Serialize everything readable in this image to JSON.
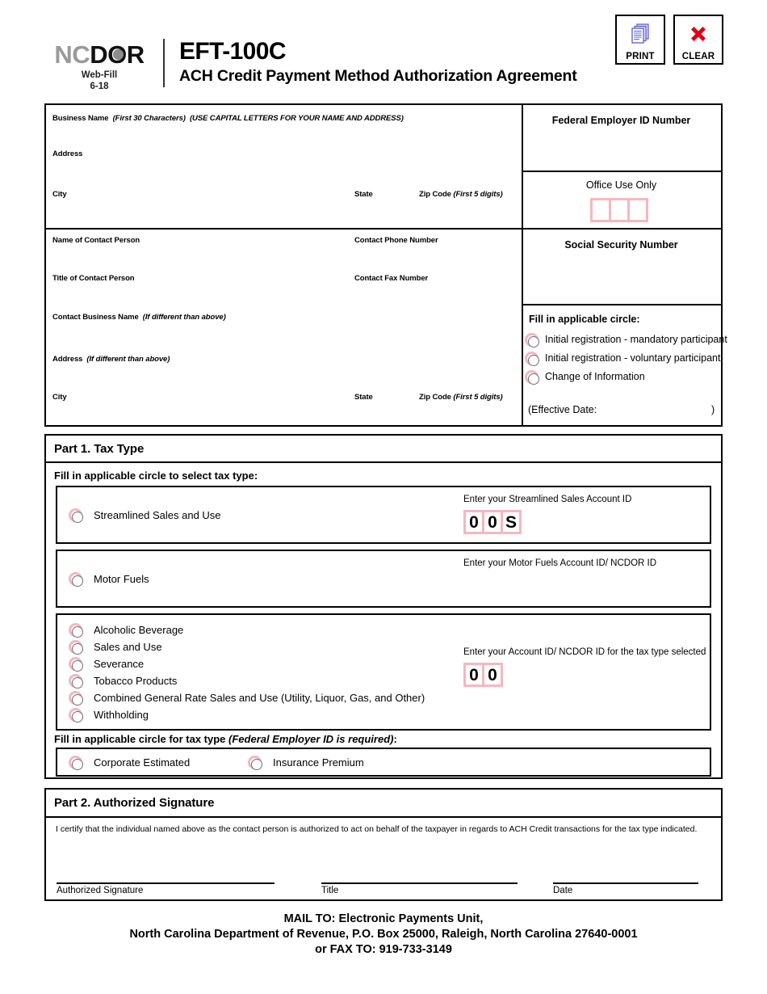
{
  "header": {
    "logo": {
      "part1": "NC",
      "part2": "DOR",
      "subtitle_line1": "Web-Fill",
      "subtitle_line2": "6-18"
    },
    "form_number": "EFT-100C",
    "form_title": "ACH Credit Payment Method Authorization Agreement",
    "print_button": "PRINT",
    "clear_button": "CLEAR"
  },
  "business": {
    "business_name_label": "Business Name",
    "business_name_note1": "(First 30 Characters)",
    "business_name_note2": "(USE CAPITAL LETTERS FOR YOUR NAME AND ADDRESS)",
    "address_label": "Address",
    "city_label": "City",
    "state_label": "State",
    "zip_label": "Zip Code",
    "zip_note": "(First 5 digits)"
  },
  "federal_id": {
    "title": "Federal Employer ID Number"
  },
  "office_use": {
    "title": "Office Use Only",
    "boxes": [
      "",
      "",
      ""
    ]
  },
  "contact": {
    "name_label": "Name of Contact Person",
    "phone_label": "Contact Phone Number",
    "title_label": "Title of Contact Person",
    "fax_label": "Contact Fax Number",
    "business_name_label": "Contact Business Name",
    "business_name_note": "(If different than above)",
    "address_label": "Address",
    "address_note": "(If different than above)",
    "city_label": "City",
    "state_label": "State",
    "zip_label": "Zip Code",
    "zip_note": "(First 5 digits)"
  },
  "ssn": {
    "title": "Social Security Number"
  },
  "registration": {
    "prompt": "Fill in applicable circle:",
    "options": [
      "Initial registration - mandatory participant",
      "Initial registration - voluntary participant",
      "Change of Information"
    ],
    "effective_date_open": "(Effective Date:",
    "effective_date_close": ")"
  },
  "part1": {
    "heading": "Part 1.  Tax Type",
    "prompt": "Fill in applicable circle to select tax type:",
    "streamlined": {
      "option_label": "Streamlined Sales and Use",
      "account_prompt": "Enter your Streamlined Sales Account ID",
      "account_boxes": [
        "0",
        "0",
        "S"
      ]
    },
    "motor_fuels": {
      "option_label": "Motor Fuels",
      "account_prompt": "Enter your Motor Fuels Account ID/ NCDOR ID"
    },
    "general": {
      "options": [
        "Alcoholic Beverage",
        "Sales and Use",
        "Severance",
        "Tobacco Products",
        "Combined General Rate Sales and Use (Utility, Liquor, Gas, and Other)",
        "Withholding"
      ],
      "account_prompt": "Enter your Account ID/ NCDOR ID for the tax type selected",
      "account_boxes": [
        "0",
        "0"
      ]
    },
    "fein_required": {
      "prompt_bold": "Fill in applicable circle for tax type",
      "prompt_italic": "(Federal Employer ID is required)",
      "prompt_colon": ":",
      "options": [
        "Corporate Estimated",
        "Insurance Premium"
      ]
    }
  },
  "part2": {
    "heading": "Part 2.  Authorized Signature",
    "certification": "I certify that the individual named above as the contact person is authorized to act on behalf of the taxpayer in regards to ACH Credit transactions for the tax type indicated.",
    "signature_label": "Authorized Signature",
    "title_label": "Title",
    "date_label": "Date"
  },
  "footer": {
    "line1": "MAIL TO:  Electronic Payments Unit,",
    "line2": "North Carolina Department of Revenue, P.O. Box 25000, Raleigh, North Carolina 27640-0001",
    "line3": "or FAX TO: 919-733-3149"
  },
  "colors": {
    "pink_border": "#f4b6c0",
    "logo_gray": "#9a9a9a",
    "clear_red": "#e00018",
    "print_blue": "#6a6ad8"
  }
}
